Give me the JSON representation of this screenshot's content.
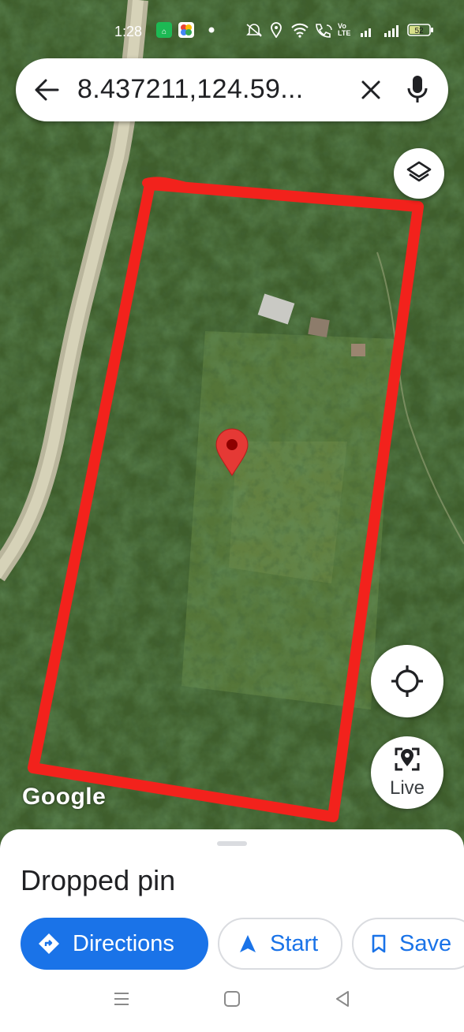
{
  "status_bar": {
    "time": "1:28",
    "battery": "52",
    "network_label": "Vo LTE"
  },
  "search": {
    "query": "8.437211,124.59..."
  },
  "map": {
    "attribution": "Google",
    "live_label": "Live"
  },
  "place_sheet": {
    "title": "Dropped pin",
    "actions": {
      "directions": "Directions",
      "start": "Start",
      "save": "Save"
    }
  },
  "colors": {
    "accent": "#1a73e8",
    "outline": "#f2221c",
    "pin": "#e53935"
  }
}
